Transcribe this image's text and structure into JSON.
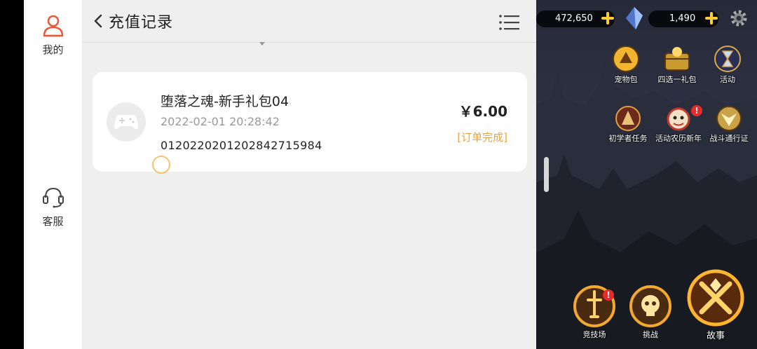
{
  "sidebar": {
    "items": [
      {
        "label": "我的",
        "icon": "user-icon"
      },
      {
        "label": "客服",
        "icon": "headset-icon"
      }
    ]
  },
  "header": {
    "title": "充值记录",
    "back_icon": "chevron-left-icon",
    "menu_icon": "list-menu-icon"
  },
  "records": [
    {
      "name": "堕落之魂-新手礼包04",
      "time": "2022-02-01 20:28:42",
      "order_id": "012022020120284271598​4",
      "price": "￥6.00",
      "status": "[订单完成]",
      "icon": "gamepad-icon"
    }
  ],
  "game": {
    "currency_gold": "472,650",
    "currency_gem": "1,490",
    "buttons_row1": [
      "宠物包",
      "四选一礼包",
      "活动"
    ],
    "buttons_row2": [
      "初学者任务",
      "活动农历新年",
      "战斗通行证"
    ],
    "buttons_bottom": [
      "竞技场",
      "挑战",
      "故事"
    ],
    "badge": "!",
    "colors": {
      "accent": "#f0a23a",
      "gold": "#ffcc33"
    }
  }
}
